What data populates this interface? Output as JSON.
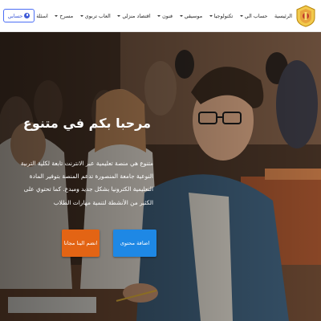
{
  "header": {
    "account_label": "حسابي",
    "menu": [
      {
        "label": "الرئيسية",
        "has_dropdown": false
      },
      {
        "label": "حساب الي",
        "has_dropdown": true
      },
      {
        "label": "تكنولوجيا",
        "has_dropdown": true
      },
      {
        "label": "موسيقي",
        "has_dropdown": true
      },
      {
        "label": "فنون",
        "has_dropdown": true
      },
      {
        "label": "اقتصاد منزلي",
        "has_dropdown": true
      },
      {
        "label": "العاب تربوي",
        "has_dropdown": true
      },
      {
        "label": "مسرح",
        "has_dropdown": true
      },
      {
        "label": "اسئلة",
        "has_dropdown": false
      }
    ]
  },
  "hero": {
    "title": "مرحبا بكم في متنوع",
    "description": "متنوع هي منصة تعليمية عبر الانترنت تابعة لكلية التربية النوعية جامعة المنصورة تدعم المنصة بتوفير المادة التعليمية الكترونيا بشكل جديد ومبدع. كما تحتوي على الكثير من الأنشطة لتنمية مهارات الطلاب",
    "add_content_label": "اضافة محتوى",
    "join_label": "انضم الينا مجانا"
  },
  "colors": {
    "primary": "#1e88e5",
    "accent": "#e36414",
    "account_border": "#4c6ef5"
  }
}
